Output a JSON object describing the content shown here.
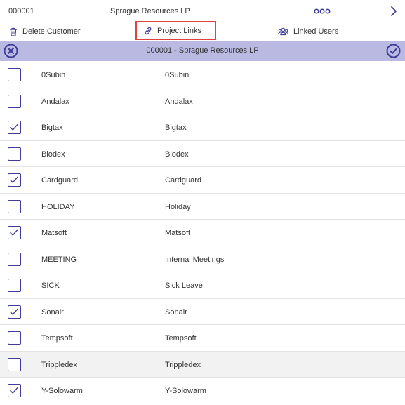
{
  "customer": {
    "id": "000001",
    "name": "Sprague Resources LP"
  },
  "actions": {
    "delete_label": "Delete Customer",
    "links_label": "Project Links",
    "users_label": "Linked Users"
  },
  "band": {
    "title": "000001 - Sprague Resources LP"
  },
  "colors": {
    "accent": "#3f3d99",
    "band": "#b9b9e2",
    "highlight": "#e0433d"
  },
  "projects": [
    {
      "code": "0Subin",
      "description": "0Subin",
      "checked": false
    },
    {
      "code": "Andalax",
      "description": "Andalax",
      "checked": false
    },
    {
      "code": "Bigtax",
      "description": "Bigtax",
      "checked": true
    },
    {
      "code": "Biodex",
      "description": "Biodex",
      "checked": false
    },
    {
      "code": "Cardguard",
      "description": "Cardguard",
      "checked": true
    },
    {
      "code": "HOLIDAY",
      "description": "Holiday",
      "checked": false
    },
    {
      "code": "Matsoft",
      "description": "Matsoft",
      "checked": true
    },
    {
      "code": "MEETING",
      "description": "Internal Meetings",
      "checked": false
    },
    {
      "code": "SICK",
      "description": "Sick Leave",
      "checked": false
    },
    {
      "code": "Sonair",
      "description": "Sonair",
      "checked": true
    },
    {
      "code": "Tempsoft",
      "description": "Tempsoft",
      "checked": false
    },
    {
      "code": "Trippledex",
      "description": "Trippledex",
      "checked": false
    },
    {
      "code": "Y-Solowarm",
      "description": "Y-Solowarm",
      "checked": true
    }
  ]
}
